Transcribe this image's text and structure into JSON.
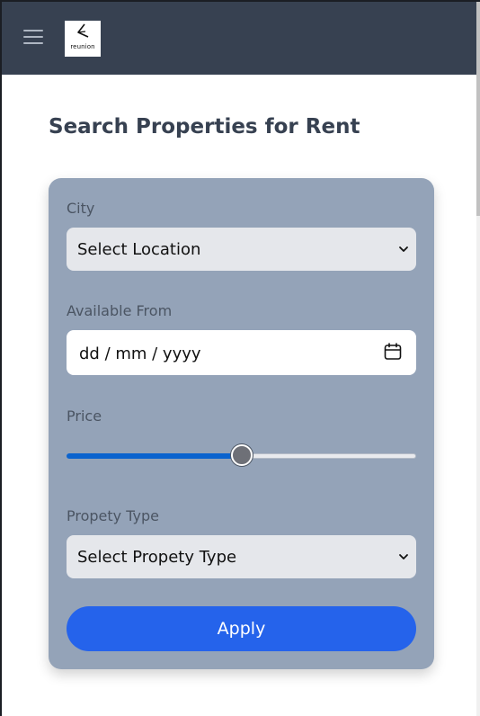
{
  "header": {
    "menu_icon": "hamburger-menu-icon",
    "logo_text": "reunion",
    "background_color": "#374151"
  },
  "page": {
    "title": "Search Properties for Rent"
  },
  "form": {
    "city": {
      "label": "City",
      "selected": "Select Location"
    },
    "available_from": {
      "label": "Available From",
      "value": "dd / mm / yyyy",
      "icon": "calendar-icon"
    },
    "price": {
      "label": "Price",
      "slider_fraction": 0.5,
      "fill_color": "#0b63ce"
    },
    "property_type": {
      "label": "Propety Type",
      "selected": "Select Propety Type"
    },
    "apply_label": "Apply",
    "apply_color": "#2563eb",
    "card_color": "#94a3b8"
  }
}
